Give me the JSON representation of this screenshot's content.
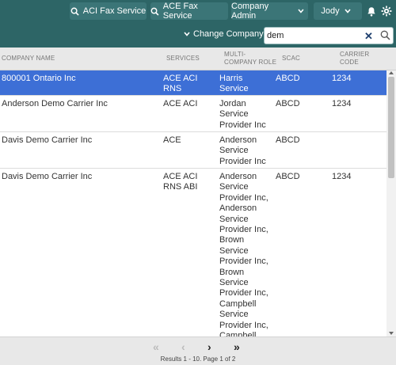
{
  "topbar": {
    "aci_fax_label": "ACI Fax Service",
    "ace_fax_label": "ACE Fax Service",
    "company_admin_label": "Company Admin",
    "user_label": "Jody"
  },
  "change_company": {
    "label": "Change Company:",
    "value": "dem"
  },
  "columns": [
    "COMPANY NAME",
    "SERVICES",
    "MULTI-\nCOMPANY ROLE",
    "SCAC",
    "CARRIER CODE"
  ],
  "rows": [
    {
      "name": "800001 Ontario Inc",
      "services": "ACE ACI RNS",
      "role": "Harris Service Provider Inc",
      "scac": "ABCD",
      "carrier": "1234",
      "selected": true
    },
    {
      "name": "Anderson Demo Carrier Inc",
      "services": "ACE ACI",
      "role": "Jordan Service Provider Inc",
      "scac": "ABCD",
      "carrier": "1234"
    },
    {
      "name": "Davis Demo Carrier Inc",
      "services": "ACE",
      "role": "Anderson Service Provider Inc",
      "scac": "ABCD",
      "carrier": ""
    },
    {
      "name": "Davis Demo Carrier Inc",
      "services": "ACE ACI RNS ABI",
      "role": "Anderson Service Provider Inc, Anderson Service Provider Inc, Brown Service Provider Inc, Brown Service Provider Inc, Campbell Service Provider Inc, Campbell Service Provider Inc",
      "scac": "ABCD",
      "carrier": "1234"
    }
  ],
  "pagination": {
    "first": "«",
    "prev": "‹",
    "next": "›",
    "last": "»",
    "summary": "Results 1 - 10. Page 1 of 2"
  },
  "icons": [
    "search-icon",
    "chevron-down-icon",
    "bell-icon",
    "settings-icon",
    "close-icon"
  ],
  "colors": {
    "topbar": "#2d6566",
    "button": "#3b7577",
    "selected_row": "#3d6fd6"
  }
}
